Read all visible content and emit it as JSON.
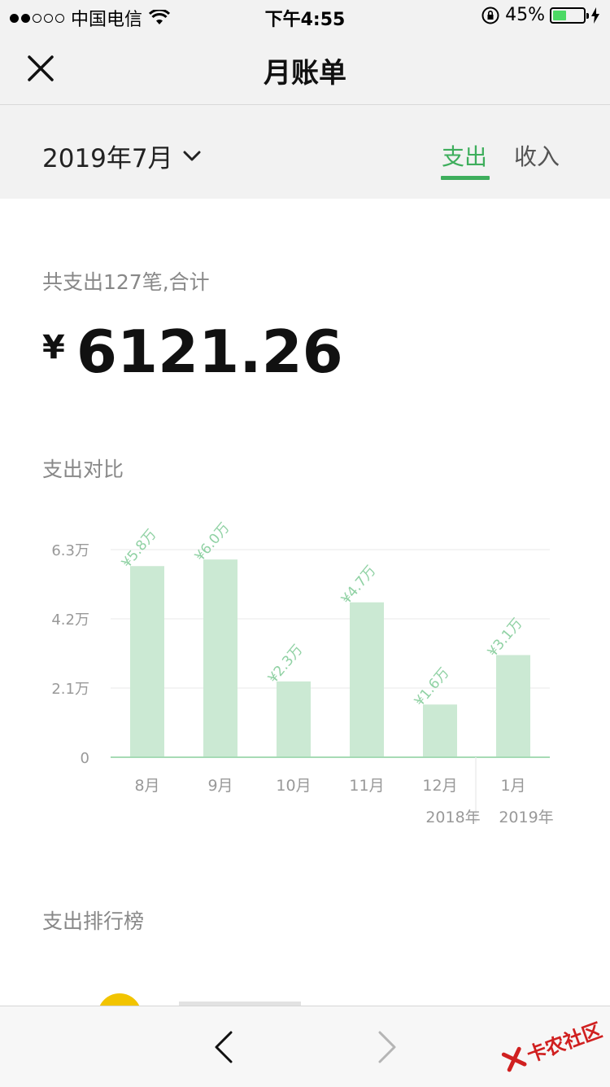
{
  "status_bar": {
    "carrier": "中国电信",
    "time": "下午4:55",
    "battery_percent": "45%",
    "battery_level": 0.45,
    "signal_strength": 2
  },
  "navbar": {
    "close_icon": "close-icon",
    "title": "月账单"
  },
  "filter": {
    "month": "2019年7月",
    "tabs": [
      {
        "label": "支出",
        "active": true
      },
      {
        "label": "收入",
        "active": false
      }
    ]
  },
  "summary": {
    "label": "共支出127笔,合计",
    "currency": "¥",
    "amount": "6121.26"
  },
  "comparison": {
    "title": "支出对比"
  },
  "chart_data": {
    "type": "bar",
    "categories": [
      "8月",
      "9月",
      "10月",
      "11月",
      "12月",
      "1月"
    ],
    "values": [
      5.8,
      6.0,
      2.3,
      4.7,
      1.6,
      3.1
    ],
    "value_labels": [
      "¥5.8万",
      "¥6.0万",
      "¥2.3万",
      "¥4.7万",
      "¥1.6万",
      "¥3.1万"
    ],
    "y_ticks": [
      0,
      2.1,
      4.2,
      6.3
    ],
    "y_tick_labels": [
      "0",
      "2.1万",
      "4.2万",
      "6.3万"
    ],
    "ylim": [
      0,
      6.3
    ],
    "year_labels": [
      {
        "label": "2018年",
        "under_category": "12月"
      },
      {
        "label": "2019年",
        "under_category": "1月"
      }
    ],
    "grid": true,
    "bar_color": "#cbe9d3",
    "label_color": "#8fd1a3"
  },
  "ranking": {
    "title": "支出排行榜"
  },
  "toolbar": {
    "back_icon": "chevron-left-icon",
    "forward_icon": "chevron-right-icon",
    "watermark": "卡农社区"
  },
  "colors": {
    "accent": "#3eae5c",
    "background_gray": "#f2f2f2"
  }
}
